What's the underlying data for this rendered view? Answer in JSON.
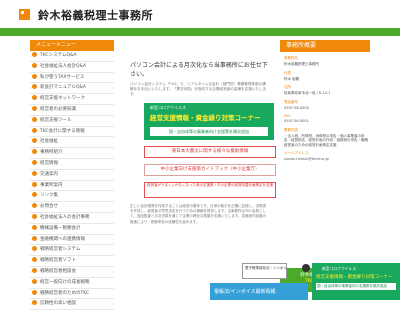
{
  "header": {
    "title": "鈴木裕義税理士事務所"
  },
  "left_nav": {
    "heading": "メニューメニュー",
    "items": [
      "TKCシステムQ&A",
      "社会福祉法人会計Q&A",
      "私が使うTAXサービス",
      "新会計マニュアルQ&A",
      "経営支援ネットワーク",
      "経営者の必要知識",
      "経営支援ツール",
      "TKC会計に関する情報",
      "社会福祉",
      "事務所紹介",
      "経営情報",
      "交通案内",
      "事業所案内",
      "リンク集",
      "お問合せ",
      "社会福祉法人の会計事務",
      "機械設備・税務会計",
      "金融機関への連携情報",
      "戦略経営者システム",
      "戦略経営者ソフト",
      "戦略経営者相談会",
      "経営一般向けの成長戦略",
      "戦略経営者のためのTKC",
      "信頼性の高い相談"
    ]
  },
  "main": {
    "intro": "パソコン会計による月次化なら当事務所にお任せ下さい。",
    "para1": "パソコン会計システム「FX2」で、リアルタイムな会計（部門別）業績管理体制の構築をお手伝いいたします。「黒字決算」を指向する企業経営者の皆様を応援いたします。",
    "banner": {
      "small": "新型コロナウイルス",
      "title": "経営支援情報・資金繰り対策コーナー",
      "sub": "国・自治体等の事業者向け支援策を順次追加"
    },
    "link1": "東日本大震災に関する様々な援助情報",
    "link2": "中小企業向け支援策ガイドブック（中小企業庁）",
    "link3": "経営者がうまくいかなくなった時の支援策 / 中小企業の経営改善計画策定を支援",
    "para2": "正しい会計帳簿を作成することは経営の基本です。日常の取引を正確に記録し、決算書を作成し、経営者が意思決定を行うための情報を提供します。当事務所はTKC会員として、巡回監査と月次決算を通じて企業の健全な発展を支援いたします。書面添付制度の推進により、税務申告の信頼性を高めます。"
  },
  "right_col": {
    "heading": "事務所概要",
    "profile": [
      {
        "label": "事務所名",
        "value": "鈴木裕義税理士事務所"
      },
      {
        "label": "代表",
        "value": "鈴木 裕義"
      },
      {
        "label": "住所",
        "value": "岐阜県岐阜市北一色 / 8-14-1"
      },
      {
        "label": "電話番号",
        "value": "0597-56-0000"
      },
      {
        "label": "FAX",
        "value": "0597-56-0001"
      },
      {
        "label": "業務内容",
        "value": "・法人税、所得税、消費税の申告・個人事業者の申告・経営助言、経営計画の作成・相続税の申告・戦略経営者のための経営計画策定支援"
      },
      {
        "label": "メールアドレス",
        "value": "suzuki-hiroshi@tkcnf.or.jp"
      }
    ],
    "association": {
      "line1": "鈴木裕義税理士事務所は",
      "line2": "TKC全国会会員です"
    }
  },
  "floating": {
    "covid_btn": "新型コロナウイルス",
    "covid_title": "経営支援情報・資金繰り対策コーナー",
    "covid_sub": "国・自治体等の事業者向け支援策を順次追加",
    "info_btn": "電子帳簿保存法・インボイス",
    "info_sub": "電帳法/インボイス最新情報"
  }
}
